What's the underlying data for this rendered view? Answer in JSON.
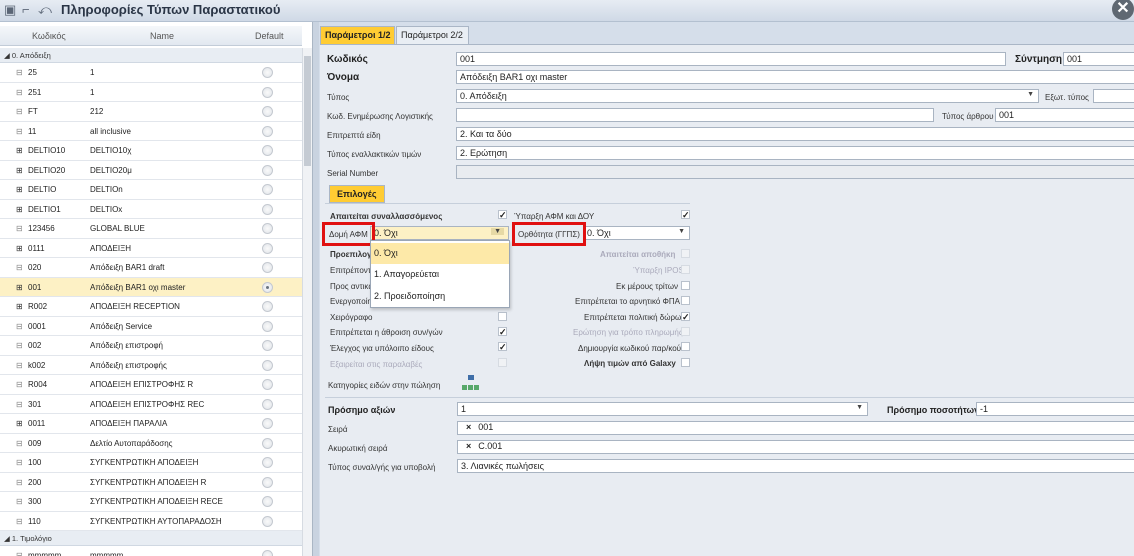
{
  "window": {
    "title": "Πληροφορίες Τύπων Παραστατικού",
    "close": "✕"
  },
  "grid": {
    "columns": [
      "Κωδικός",
      "Name",
      "Default"
    ],
    "groups": [
      {
        "label": "0. Απόδειξη"
      },
      {
        "label": "1. Τιμολόγιο"
      }
    ],
    "rows": [
      {
        "exp": "⊟",
        "code": "25",
        "name": "1",
        "def": false
      },
      {
        "exp": "⊟",
        "code": "251",
        "name": "1",
        "def": false
      },
      {
        "exp": "⊟",
        "code": "FT",
        "name": "212",
        "def": false
      },
      {
        "exp": "⊟",
        "code": "11",
        "name": "all inclusive",
        "def": false
      },
      {
        "exp": "⊞",
        "code": "DELTIO10",
        "name": "DELTIO10χ",
        "def": false
      },
      {
        "exp": "⊞",
        "code": "DELTIO20",
        "name": "DELTIO20μ",
        "def": false
      },
      {
        "exp": "⊞",
        "code": "DELTIO",
        "name": "DELTIOn",
        "def": false
      },
      {
        "exp": "⊞",
        "code": "DELTIO1",
        "name": "DELTIOx",
        "def": false
      },
      {
        "exp": "⊟",
        "code": "123456",
        "name": "GLOBAL BLUE",
        "def": false
      },
      {
        "exp": "⊞",
        "code": "0111",
        "name": "ΑΠΟΔΕΙΞΗ",
        "def": false
      },
      {
        "exp": "⊟",
        "code": "020",
        "name": "Απόδειξη BAR1  draft",
        "def": false
      },
      {
        "exp": "⊞",
        "code": "001",
        "name": "Απόδειξη BAR1 οχι master",
        "def": true
      },
      {
        "exp": "⊞",
        "code": "R002",
        "name": "ΑΠΟΔΕΙΞΗ RECEPTION",
        "def": false
      },
      {
        "exp": "⊟",
        "code": "0001",
        "name": "Απόδειξη Service",
        "def": false
      },
      {
        "exp": "⊟",
        "code": "002",
        "name": "Απόδειξη επιστροφή",
        "def": false
      },
      {
        "exp": "⊟",
        "code": "k002",
        "name": "Απόδειξη επιστροφής",
        "def": false
      },
      {
        "exp": "⊟",
        "code": "R004",
        "name": "ΑΠΟΔΕΙΞΗ ΕΠΙΣΤΡΟΦΗΣ R",
        "def": false
      },
      {
        "exp": "⊟",
        "code": "301",
        "name": "ΑΠΟΔΕΙΞΗ ΕΠΙΣΤΡΟΦΗΣ REC",
        "def": false
      },
      {
        "exp": "⊞",
        "code": "0011",
        "name": "ΑΠΟΔΕΙΞΗ ΠΑΡΑΛΙΑ",
        "def": false
      },
      {
        "exp": "⊟",
        "code": "009",
        "name": "Δελτίο Αυτοπαράδοσης",
        "def": false
      },
      {
        "exp": "⊟",
        "code": "100",
        "name": "ΣΥΓΚΕΝΤΡΩΤΙΚΗ ΑΠΟΔΕΙΞΗ",
        "def": false
      },
      {
        "exp": "⊟",
        "code": "200",
        "name": "ΣΥΓΚΕΝΤΡΩΤΙΚΗ ΑΠΟΔΕΙΞΗ R",
        "def": false
      },
      {
        "exp": "⊟",
        "code": "300",
        "name": "ΣΥΓΚΕΝΤΡΩΤΙΚΗ ΑΠΟΔΕΙΞΗ RECE",
        "def": false
      },
      {
        "exp": "⊟",
        "code": "110",
        "name": "ΣΥΓΚΕΝΤΡΩΤΙΚΗ ΑΥΤΟΠΑΡΑΔΟΣΗ",
        "def": false
      }
    ],
    "last_row": {
      "exp": "⊟",
      "code": "mmmmm",
      "name": "mmmmm"
    }
  },
  "tabs": [
    "Παράμετροι 1/2",
    "Παράμετροι 2/2"
  ],
  "form": {
    "kodikos_label": "Κωδικός",
    "kodikos": "001",
    "syntomisi_label": "Σύντμηση",
    "syntomisi": "001",
    "onoma_label": "Όνομα",
    "onoma": "Απόδειξη BAR1 οχι master",
    "typos_label": "Τύπος",
    "typos": "0. Απόδειξη",
    "ekstyp_label": "Εξωτ. τύπος",
    "ekstyp": "",
    "kod_label": "Κωδ. Ενημέρωσης Λογιστικής",
    "kod": "",
    "typos_arthrou_label": "Τύπος άρθρου",
    "typos_arthrou": "001",
    "eidi_label": "Επιτρεπτά είδη",
    "eidi": "2. Και τα δύο",
    "timon_label": "Τύπος εναλλακτικών τιμών",
    "timon": "2. Ερώτηση",
    "serial_label": "Serial Number",
    "serial": ""
  },
  "options_tab": "Επιλογές",
  "options": {
    "apaiteitai": "Απαιτείται συναλλασσόμενος",
    "yparxi": "Ύπαρξη ΑΦΜ και ΔΟΥ",
    "domi_label": "Δομή ΑΦΜ",
    "domi_value": "0. Όχι",
    "orthotita_label": "Ορθότητα (ΓΓΠΣ)",
    "orthotita_value": "0. Όχι",
    "proepilogi": "Προεπιλογ",
    "epitrep": "Επιτρέποντ",
    "pros": "Προς αντικα",
    "energ": "Ενεργοποίη",
    "xeirografo": "Χειρόγραφο",
    "athroisi": "Επιτρέπεται η άθροιση συν/γών",
    "elegxos": "Έλεγχος για υπόλοιπο είδους",
    "exairesi": "Εξαιρείται στις παραλαβές",
    "apothiki": "Απαιτείται αποθήκη",
    "ipos": "Ύπαρξη IPOS",
    "tritwn": "Εκ μέρους τρίτων",
    "fpa": "Επιτρέπεται το αρνητικό ΦΠΑ",
    "dwrwn": "Επιτρέπεται πολιτική δώρων",
    "tropo": "Ερώτηση για τρόπο πληρωμής",
    "dimiourgia": "Δημιουργία κωδικού παρ/κού",
    "galaxy": "Λήψη τιμών από Galaxy",
    "kathgories": "Κατηγορίες ειδών στην πώληση"
  },
  "popup": [
    "0. Όχι",
    "1. Απαγορεύεται",
    "2. Προειδοποίηση"
  ],
  "bottom": {
    "prosimo_label": "Πρόσημο αξιών",
    "prosimo": "1",
    "posotiton_label": "Πρόσημο ποσοτήτων",
    "posotiton": "-1",
    "seira_label": "Σειρά",
    "seira": "001",
    "akyrotiki_label": "Ακυρωτική σειρά",
    "akyrotiki": "C.001",
    "synal_label": "Τύπος συναλ/γής για υποβολή",
    "synal": "3. Λιανικές πωλήσεις"
  }
}
